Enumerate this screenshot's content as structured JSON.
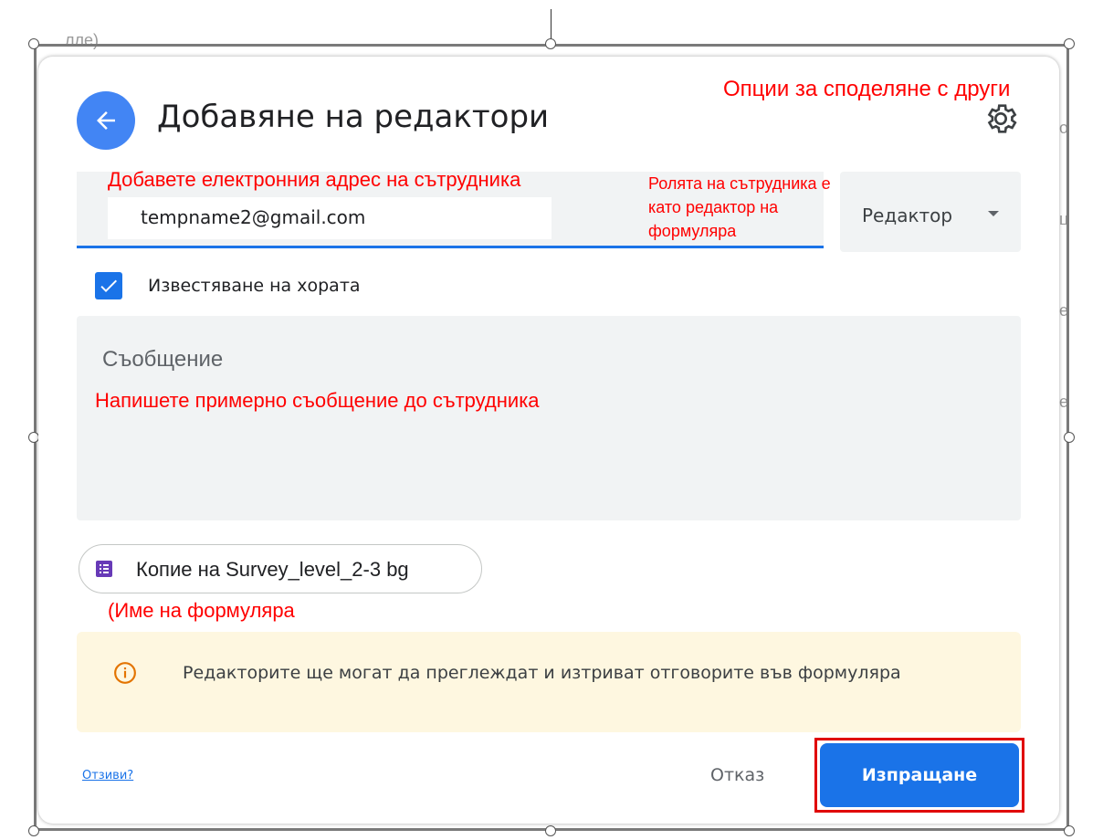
{
  "dialog": {
    "title": "Добавяне на редактори",
    "email_value": "tempname2@gmail.com",
    "role_label": "Редактор",
    "notify_label": "Известяване на хората",
    "message_placeholder": "Съобщение",
    "form_chip_label": "Копие на Survey_level_2-3 bg",
    "info_text": "Редакторите ще могат да преглеждат и изтриват отговорите във формуляра",
    "feedback_link": "Отзиви?",
    "cancel_label": "Отказ",
    "send_label": "Изпращане"
  },
  "annotations": {
    "share_options": "Опции за споделяне с други",
    "add_email": "Добавете електронния адрес на сътрудника",
    "role_note": "Ролята на сътрудника е като редактор на формуляра",
    "message_note": "Напишете примерно съобщение до сътрудника",
    "form_name_note": "(Име на формуляра"
  },
  "icons": {
    "back": "arrow-left-icon",
    "settings": "gear-icon",
    "checkbox": "check-icon",
    "form": "forms-list-icon",
    "info": "info-icon",
    "dropdown": "caret-down-icon"
  },
  "colors": {
    "accent": "#1a73e8",
    "back_button": "#4285f4",
    "annotation": "#ff0000",
    "info_bg": "#fef7e0",
    "form_icon": "#673ab7"
  }
}
